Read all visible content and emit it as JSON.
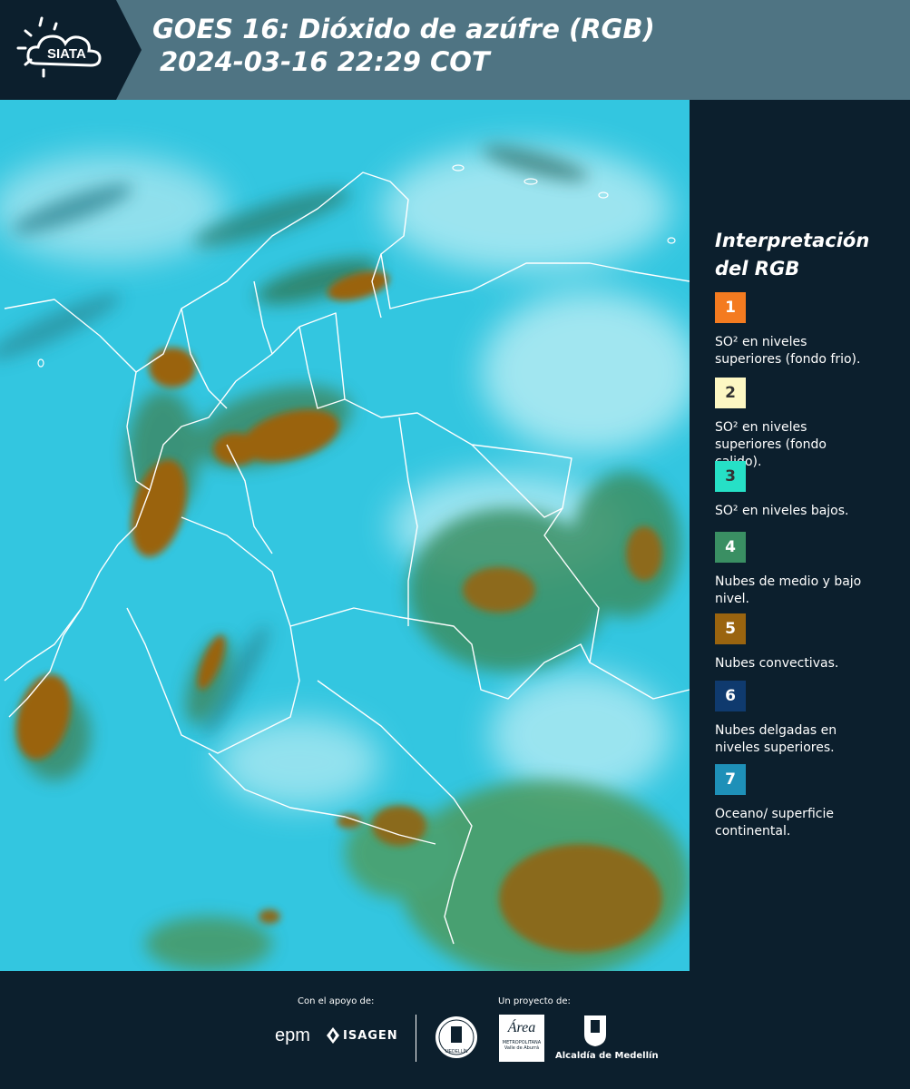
{
  "header": {
    "logo_text": "SIATA",
    "title_line1": "GOES 16: Dióxido de azúfre (RGB)",
    "title_line2": "2024-03-16 22:29 COT"
  },
  "legend": {
    "title_line1": "Interpretación",
    "title_line2": "del RGB",
    "items": [
      {
        "number": "1",
        "color": "#f47b20",
        "description": "SO² en niveles\nsuperiores (fondo frio)."
      },
      {
        "number": "2",
        "color": "#fdf7c3",
        "description": "SO² en niveles\nsuperiores (fondo\ncalido)."
      },
      {
        "number": "3",
        "color": "#26e0c6",
        "description": "SO² en niveles bajos."
      },
      {
        "number": "4",
        "color": "#3a8f63",
        "description": "Nubes de medio y bajo\nnivel."
      },
      {
        "number": "5",
        "color": "#9a640f",
        "description": "Nubes convectivas."
      },
      {
        "number": "6",
        "color": "#0f3a6e",
        "description": "Nubes delgadas en\nniveles superiores."
      },
      {
        "number": "7",
        "color": "#1e90b8",
        "description": "Oceano/ superficie\ncontinental."
      }
    ]
  },
  "footer": {
    "support_label": "Con el apoyo de:",
    "project_label": "Un proyecto de:",
    "sponsor1": "epm",
    "sponsor2": "ISAGEN",
    "partner_area_main": "Área",
    "partner_area_sub1": "METROPOLITANA",
    "partner_area_sub2": "Valle de Aburrá",
    "partner_alcaldia": "Alcaldía de Medellín",
    "seal_text": "MEDELLÍN"
  },
  "colors": {
    "header_bg": "#4f7483",
    "page_bg": "#0c1f2d",
    "map_cyan": "#33c6e0",
    "cloud_brown": "#9a640f",
    "cloud_green": "#3a8f63"
  }
}
